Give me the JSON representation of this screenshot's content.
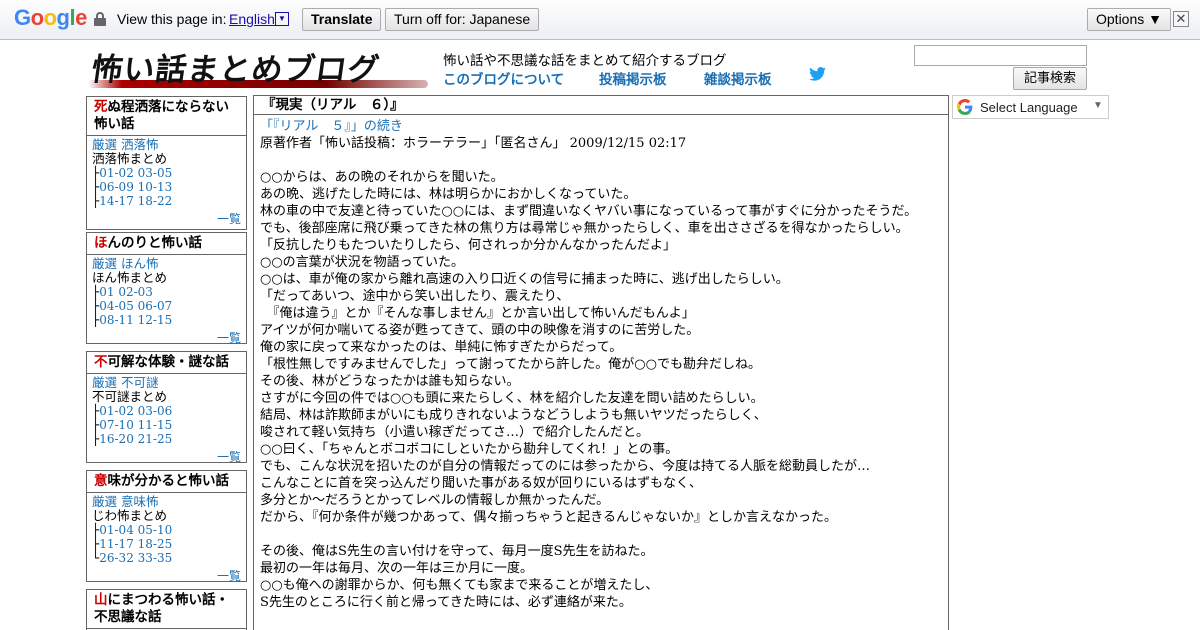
{
  "translate_bar": {
    "logo_letters": [
      "G",
      "o",
      "o",
      "g",
      "l",
      "e"
    ],
    "logo_colors": [
      "#4285f4",
      "#ea4335",
      "#fbbc05",
      "#4285f4",
      "#34a853",
      "#ea4335"
    ],
    "view_text": "View this page in:",
    "language": "English",
    "translate_label": "Translate",
    "turn_off_label": "Turn off for: Japanese",
    "options_label": "Options ▼",
    "close_label": "✕"
  },
  "header": {
    "logo_text": "怖い話まとめブログ",
    "tagline": "怖い話や不思議な話をまとめて紹介するブログ",
    "nav": [
      "このブログについて",
      "投稿掲示板",
      "雑談掲示板"
    ],
    "search_placeholder": "",
    "search_button": "記事検索"
  },
  "sidebar": [
    {
      "title_red": "死",
      "title_rest": "ぬ程洒落にならない怖い話",
      "line1": "厳選 洒落怖",
      "line2": "洒落怖まとめ",
      "tree": [
        [
          "├",
          "01-02 03-05"
        ],
        [
          "├",
          "06-09 10-13"
        ],
        [
          "├",
          "14-17 18-22"
        ]
      ],
      "more": "一覧"
    },
    {
      "title_red": "ほ",
      "title_rest": "んのりと怖い話",
      "line1": "厳選 ほん怖",
      "line2": "ほん怖まとめ",
      "tree": [
        [
          "├",
          "01 02-03"
        ],
        [
          "├",
          "04-05 06-07"
        ],
        [
          "├",
          "08-11 12-15"
        ]
      ],
      "more": "一覧"
    },
    {
      "title_red": "不",
      "title_rest": "可解な体験・謎な話",
      "line1": "厳選 不可謎",
      "line2": "不可謎まとめ",
      "tree": [
        [
          "├",
          "01-02 03-06"
        ],
        [
          "├",
          "07-10 11-15"
        ],
        [
          "├",
          "16-20 21-25"
        ]
      ],
      "more": "一覧"
    },
    {
      "title_red": "意",
      "title_rest": "味が分かると怖い話",
      "line1": "厳選 意味怖",
      "line2": "じわ怖まとめ",
      "tree": [
        [
          "├",
          "01-04 05-10"
        ],
        [
          "├",
          "11-17 18-25"
        ],
        [
          "└",
          "26-32 33-35"
        ]
      ],
      "more": "一覧"
    },
    {
      "title_red": "山",
      "title_rest": "にまつわる怖い話・不思議な話",
      "line1": "",
      "line2": "",
      "tree": [],
      "more": ""
    }
  ],
  "post": {
    "title": "『現実（リアル　６）』",
    "continuation": "「『リアル　５』」の続き",
    "meta": "原著作者「怖い話投稿：ホラーテラー」「匿名さん」 2009/12/15 02:17",
    "lines": [
      "",
      "○○からは、あの晩のそれからを聞いた。",
      "あの晩、逃げたした時には、林は明らかにおかしくなっていた。",
      "林の車の中で友達と待っていた○○には、まず間違いなくヤバい事になっているって事がすぐに分かったそうだ。",
      "でも、後部座席に飛び乗ってきた林の焦り方は尋常じゃ無かったらしく、車を出ささざるを得なかったらしい。",
      "「反抗したりもたついたりしたら、何されっか分かんなかったんだよ」",
      "○○の言葉が状況を物語っていた。",
      "○○は、車が俺の家から離れ高速の入り口近くの信号に捕まった時に、逃げ出したらしい。",
      "「だってあいつ、途中から笑い出したり、震えたり、",
      "　『俺は違う』とか『そんな事しません』とか言い出して怖いんだもんよ」",
      "アイツが何か喘いてる姿が甦ってきて、頭の中の映像を消すのに苦労した。",
      "俺の家に戻って来なかったのは、単純に怖すぎたからだって。",
      "「根性無しですみませんでした」って謝ってたから許した。俺が○○でも勘弁だしね。",
      "その後、林がどうなったかは誰も知らない。",
      "さすがに今回の件では○○も頭に来たらしく、林を紹介した友達を問い詰めたらしい。",
      "結局、林は詐欺師まがいにも成りきれないようなどうしようも無いヤツだったらしく、",
      "唆されて軽い気持ち（小遣い稼ぎだってさ…）で紹介したんだと。",
      "○○曰く、「ちゃんとボコボコにしといたから勘弁してくれ！」との事。",
      "でも、こんな状況を招いたのが自分の情報だってのには参ったから、今度は持てる人脈を総動員したが…",
      "こんなことに首を突っ込んだり聞いた事がある奴が回りにいるはずもなく、",
      "多分とか～だろうとかってレベルの情報しか無かったんだ。",
      "だから、『何か条件が幾つかあって、偶々揃っちゃうと起きるんじゃないか』としか言えなかった。",
      "",
      "その後、俺はS先生の言い付けを守って、毎月一度S先生を訪ねた。",
      "最初の一年は毎月、次の一年は三か月に一度。",
      "○○も俺への謝罪からか、何も無くても家まで来ることが増えたし、",
      "S先生のところに行く前と帰ってきた時には、必ず連絡が来た。"
    ]
  },
  "language_widget": {
    "label": "Select Language",
    "caret": "▼"
  }
}
